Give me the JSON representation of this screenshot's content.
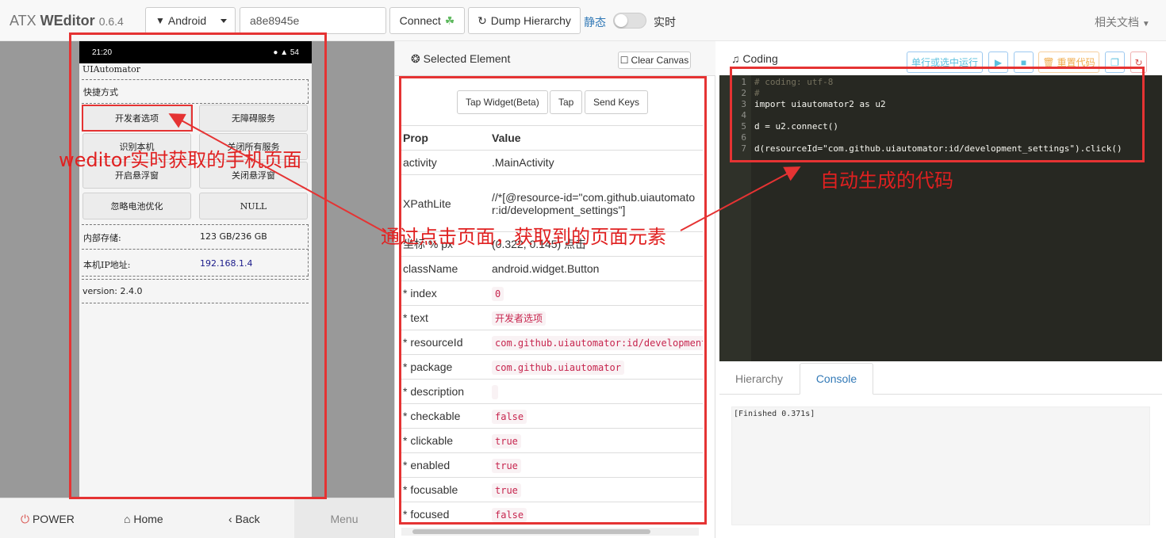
{
  "app": {
    "brand_prefix": "ATX ",
    "brand_name": "WEditor",
    "version": "0.6.4"
  },
  "navbar": {
    "platform": "Android",
    "serial": "a8e8945e",
    "connect_label": "Connect",
    "dump_label": "Dump Hierarchy",
    "static_label": "静态",
    "live_label": "实时",
    "docs_label": "相关文档"
  },
  "phone": {
    "status_time": "21:20",
    "status_right": "54",
    "app_title": "UIAutomator",
    "shortcut_label": "快捷方式",
    "buttons": [
      "开发者选项",
      "无障碍服务",
      "识别本机",
      "关闭所有服务",
      "开启悬浮窗",
      "关闭悬浮窗",
      "忽略电池优化",
      "NULL"
    ],
    "storage_label": "内部存储:",
    "storage_value": "123 GB/236 GB",
    "ip_label": "本机IP地址:",
    "ip_value": "192.168.1.4",
    "version": "version: 2.4.0"
  },
  "bottom_bar": {
    "power": "POWER",
    "home": "Home",
    "back": "Back",
    "menu": "Menu"
  },
  "selected": {
    "title": "Selected Element",
    "clear_canvas": "Clear Canvas",
    "tap_widget": "Tap Widget(Beta)",
    "tap": "Tap",
    "send_keys": "Send Keys",
    "header_prop": "Prop",
    "header_value": "Value",
    "rows": [
      {
        "k": "activity",
        "v": ".MainActivity"
      },
      {
        "k": "XPathLite",
        "v": "//*[@resource-id=\"com.github.uiautomator:id/development_settings\"]"
      },
      {
        "k": "坐标 % px",
        "v": "(0.322, 0.145) 点击"
      },
      {
        "k": "className",
        "v": "android.widget.Button"
      },
      {
        "k": "* index",
        "v": "0"
      },
      {
        "k": "* text",
        "v": "开发者选项"
      },
      {
        "k": "* resourceId",
        "v": "com.github.uiautomator:id/development_"
      },
      {
        "k": "* package",
        "v": "com.github.uiautomator"
      },
      {
        "k": "* description",
        "v": ""
      },
      {
        "k": "* checkable",
        "v": "false"
      },
      {
        "k": "* clickable",
        "v": "true"
      },
      {
        "k": "* enabled",
        "v": "true"
      },
      {
        "k": "* focusable",
        "v": "true"
      },
      {
        "k": "* focused",
        "v": "false"
      }
    ]
  },
  "coding": {
    "title": "Coding",
    "run_label": "单行或选中运行",
    "reset_label": "重置代码",
    "lines": [
      "# coding: utf-8",
      "#",
      "import uiautomator2 as u2",
      "",
      "d = u2.connect()",
      "",
      "d(resourceId=\"com.github.uiautomator:id/development_settings\").click()"
    ],
    "line_numbers": [
      "1",
      "2",
      "3",
      "4",
      "5",
      "6",
      "7"
    ]
  },
  "tabs": {
    "hierarchy": "Hierarchy",
    "console": "Console"
  },
  "console_output": "[Finished 0.371s]",
  "annotations": {
    "phone": "weditor实时获取的手机页面",
    "element": "通过点击页面，获取到的页面元素",
    "code": "自动生成的代码"
  },
  "colors": {
    "annotation": "#e53333",
    "link": "#337ab7",
    "editor_bg": "#272822"
  }
}
